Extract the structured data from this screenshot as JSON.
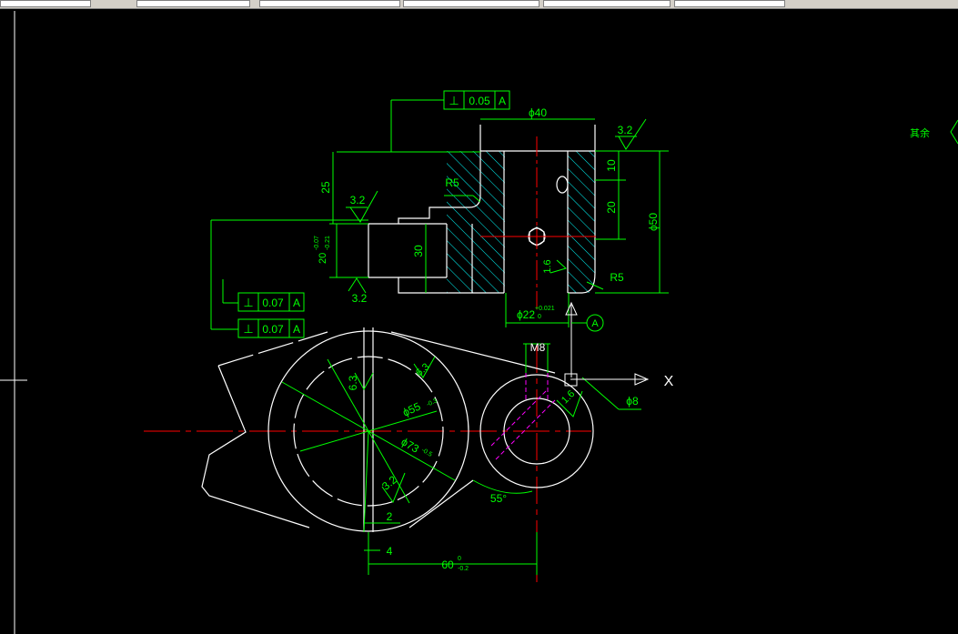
{
  "toolbar": {
    "layer_label": "",
    "cells": [
      "",
      "",
      "",
      "",
      "",
      "",
      ""
    ]
  },
  "colors": {
    "background": "#000000",
    "outline": "#ffffff",
    "dimension": "#00ff00",
    "centerline": "#ff0000",
    "hidden": "#ff00ff",
    "hatch": "#00ffff",
    "crosshair": "#ffffff"
  },
  "ucs": {
    "x_label": "X"
  },
  "annotations": {
    "fcf_top": {
      "symbol": "⊥",
      "tolerance": "0.05",
      "datum": "A"
    },
    "fcf_mid": {
      "symbol": "⊥",
      "tolerance": "0.07",
      "datum": "A"
    },
    "fcf_low": {
      "symbol": "⊥",
      "tolerance": "0.07",
      "datum": "A"
    },
    "datum_flag": "A",
    "dim_phi40": "ϕ40",
    "rough_top_right": "3.2",
    "dim_10": "10",
    "dim_20": "20",
    "dim_phi50": "ϕ50",
    "dim_25": "25",
    "r5_upper": "R5",
    "rough_left": "3.2",
    "dim_20tol": "20",
    "dim_20tol_up": "-0.07",
    "dim_20tol_lo": "-0.21",
    "dim_30": "30",
    "rough_bottom": "3.2",
    "rough_16_upper": "1.6",
    "r5_lower": "R5",
    "dim_phi22": "ϕ22",
    "dim_phi22_tol_up": "+0.021",
    "dim_phi22_tol_lo": "0",
    "dim_m8": "M8",
    "rough_63": "6.3",
    "rough_63b": "6.3",
    "dim_phi55": "ϕ55",
    "dim_phi55_tol": "-0.3",
    "dim_phi73": "ϕ73",
    "dim_phi73_tol": "-0.5",
    "rough_32_circle": "3.2",
    "rough_16_lower": "1.6",
    "dim_phi8": "ϕ8",
    "dim_55deg": "55°",
    "dim_2": "2",
    "dim_4": "4",
    "dim_60": "60",
    "dim_60_tol_up": "0",
    "dim_60_tol_lo": "-0.2",
    "side_note": "其余"
  }
}
